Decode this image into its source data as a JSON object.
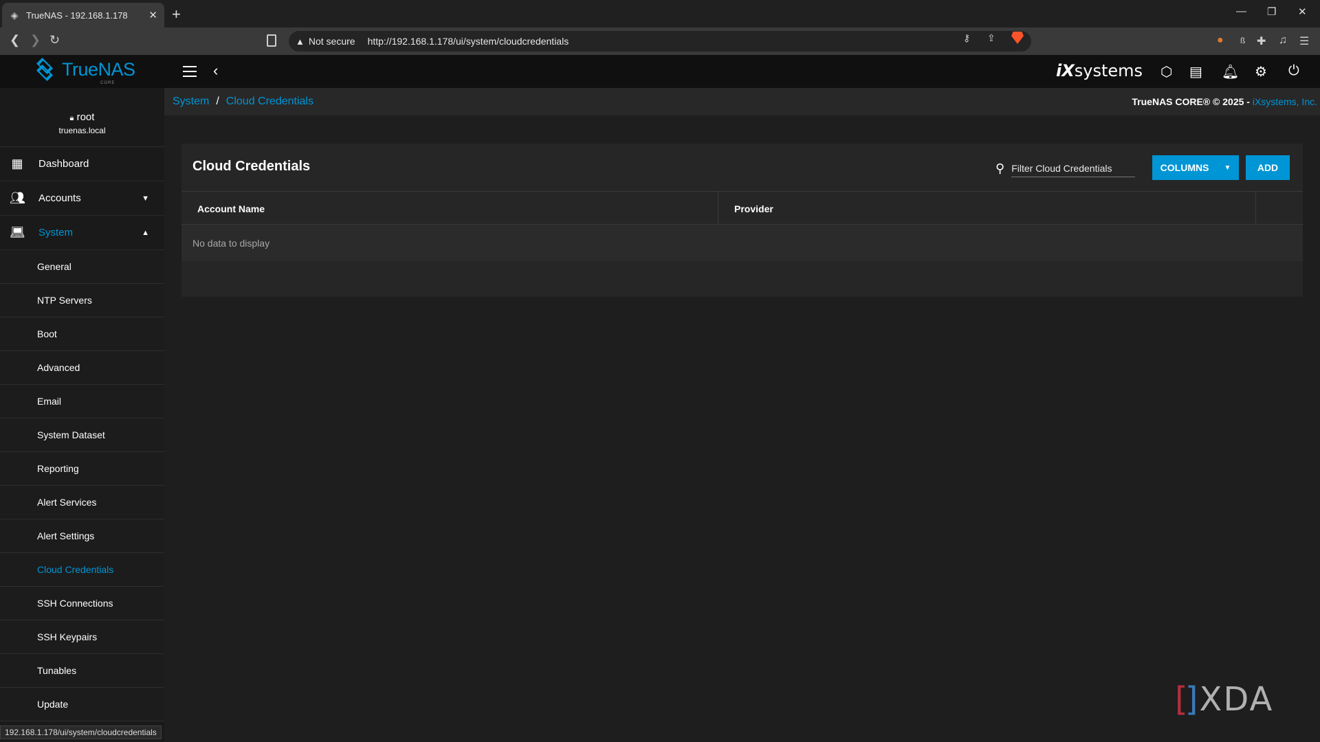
{
  "browser": {
    "tab_title": "TrueNAS - 192.168.1.178",
    "not_secure": "Not secure",
    "url": "http://192.168.1.178/ui/system/cloudcredentials",
    "status_url": "192.168.1.178/ui/system/cloudcredentials"
  },
  "app": {
    "brand": "TrueNAS",
    "brand_sub": "CORE",
    "vendor": "systems",
    "vendor_prefix": "iX"
  },
  "user": {
    "name": "root",
    "host": "truenas.local"
  },
  "sidebar": {
    "main": [
      {
        "label": "Dashboard",
        "icon": "dashboard-icon"
      },
      {
        "label": "Accounts",
        "icon": "people-icon"
      },
      {
        "label": "System",
        "icon": "laptop-icon"
      }
    ],
    "system_items": [
      "General",
      "NTP Servers",
      "Boot",
      "Advanced",
      "Email",
      "System Dataset",
      "Reporting",
      "Alert Services",
      "Alert Settings",
      "Cloud Credentials",
      "SSH Connections",
      "SSH Keypairs",
      "Tunables",
      "Update"
    ],
    "active_item": "Cloud Credentials"
  },
  "breadcrumb": {
    "parent": "System",
    "separator": "/",
    "current": "Cloud Credentials"
  },
  "copyright": {
    "text": "TrueNAS CORE® © 2025 - ",
    "link": "iXsystems, Inc."
  },
  "card": {
    "title": "Cloud Credentials",
    "filter_placeholder": "Filter Cloud Credentials",
    "columns_label": "COLUMNS",
    "add_label": "ADD",
    "headers": [
      "Account Name",
      "Provider"
    ],
    "empty_text": "No data to display"
  },
  "watermark": "XDA",
  "colors": {
    "accent": "#0095d5",
    "background": "#1e1e1e",
    "card": "#262626",
    "sidebar": "#1a1a1a"
  }
}
